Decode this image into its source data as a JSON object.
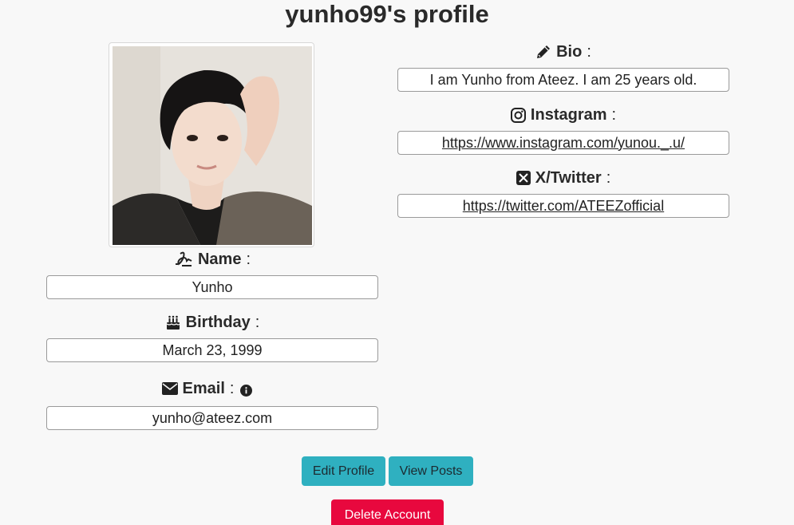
{
  "page": {
    "title": "yunho99's profile"
  },
  "profile": {
    "avatar_alt": "profile photo"
  },
  "fields": {
    "name": {
      "label": "Name",
      "value": "Yunho"
    },
    "birthday": {
      "label": "Birthday",
      "value": "March 23, 1999"
    },
    "email": {
      "label": "Email",
      "value": "yunho@ateez.com"
    },
    "bio": {
      "label": "Bio",
      "value": "I am Yunho from Ateez. I am 25 years old."
    },
    "instagram": {
      "label": "Instagram",
      "value": "https://www.instagram.com/yunou._.u/"
    },
    "twitter": {
      "label": "X/Twitter",
      "value": "https://twitter.com/ATEEZofficial"
    }
  },
  "colon": ":",
  "actions": {
    "edit_label": "Edit Profile",
    "view_posts_label": "View Posts",
    "delete_label": "Delete Account"
  },
  "icons": {
    "name": "signature-icon",
    "birthday": "birthday-cake-icon",
    "email": "envelope-icon",
    "info": "info-circle-icon",
    "bio": "pencil-icon",
    "instagram": "instagram-icon",
    "twitter": "x-twitter-icon"
  },
  "colors": {
    "teal": "#2fb0c0",
    "red": "#e8083e"
  }
}
